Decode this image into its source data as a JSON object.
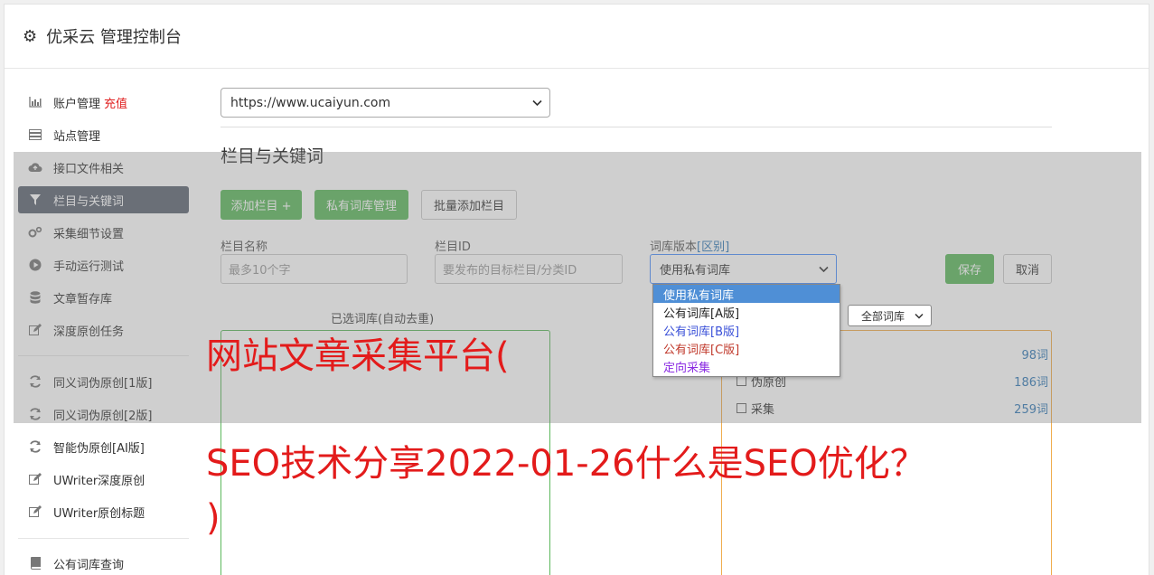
{
  "header": {
    "title": "优采云 管理控制台",
    "icon": "gear-icon"
  },
  "sidebar": {
    "items": [
      {
        "label": "账户管理",
        "badge": "充值",
        "icon": "bar-chart-icon"
      },
      {
        "label": "站点管理",
        "icon": "server-icon"
      },
      {
        "label": "接口文件相关",
        "icon": "cloud-upload-icon"
      },
      {
        "label": "栏目与关键词",
        "icon": "filter-icon",
        "active": true
      },
      {
        "label": "采集细节设置",
        "icon": "cogs-icon"
      },
      {
        "label": "手动运行测试",
        "icon": "play-circle-icon"
      },
      {
        "label": "文章暂存库",
        "icon": "database-icon"
      },
      {
        "label": "深度原创任务",
        "icon": "edit-icon"
      },
      {
        "label": "同义词伪原创[1版]",
        "icon": "refresh-icon"
      },
      {
        "label": "同义词伪原创[2版]",
        "icon": "refresh-icon"
      },
      {
        "label": "智能伪原创[AI版]",
        "icon": "refresh-icon"
      },
      {
        "label": "UWriter深度原创",
        "icon": "edit-icon"
      },
      {
        "label": "UWriter原创标题",
        "icon": "edit-icon"
      },
      {
        "label": "公有词库查询",
        "icon": "book-icon"
      }
    ]
  },
  "main": {
    "site_select": "https://www.ucaiyun.com",
    "section_title": "栏目与关键词",
    "buttons": {
      "add_column": "添加栏目 +",
      "private_lib": "私有词库管理",
      "batch_add": "批量添加栏目"
    },
    "form": {
      "column_name_label": "栏目名称",
      "column_name_placeholder": "最多10个字",
      "column_id_label": "栏目ID",
      "column_id_placeholder": "要发布的目标栏目/分类ID",
      "lib_version_label": "词库版本",
      "lib_version_hint": "[区别]",
      "lib_version_value": "使用私有词库",
      "save": "保存",
      "cancel": "取消"
    },
    "dropdown_options": [
      "使用私有词库",
      "公有词库[A版]",
      "公有词库[B版]",
      "公有词库[C版]",
      "定向采集"
    ],
    "selected_libs_title": "已选词库(自动去重)",
    "all_libs_filter": "全部词库",
    "lib_rows": [
      {
        "label": "",
        "count": "98词"
      },
      {
        "label": "伪原创",
        "count": "186词"
      },
      {
        "label": "采集",
        "count": "259词"
      }
    ]
  },
  "watermark": {
    "line1": "网站文章采集平台(",
    "line2": "SEO技术分享2022-01-26什么是SEO优化？",
    "line3": ")"
  }
}
